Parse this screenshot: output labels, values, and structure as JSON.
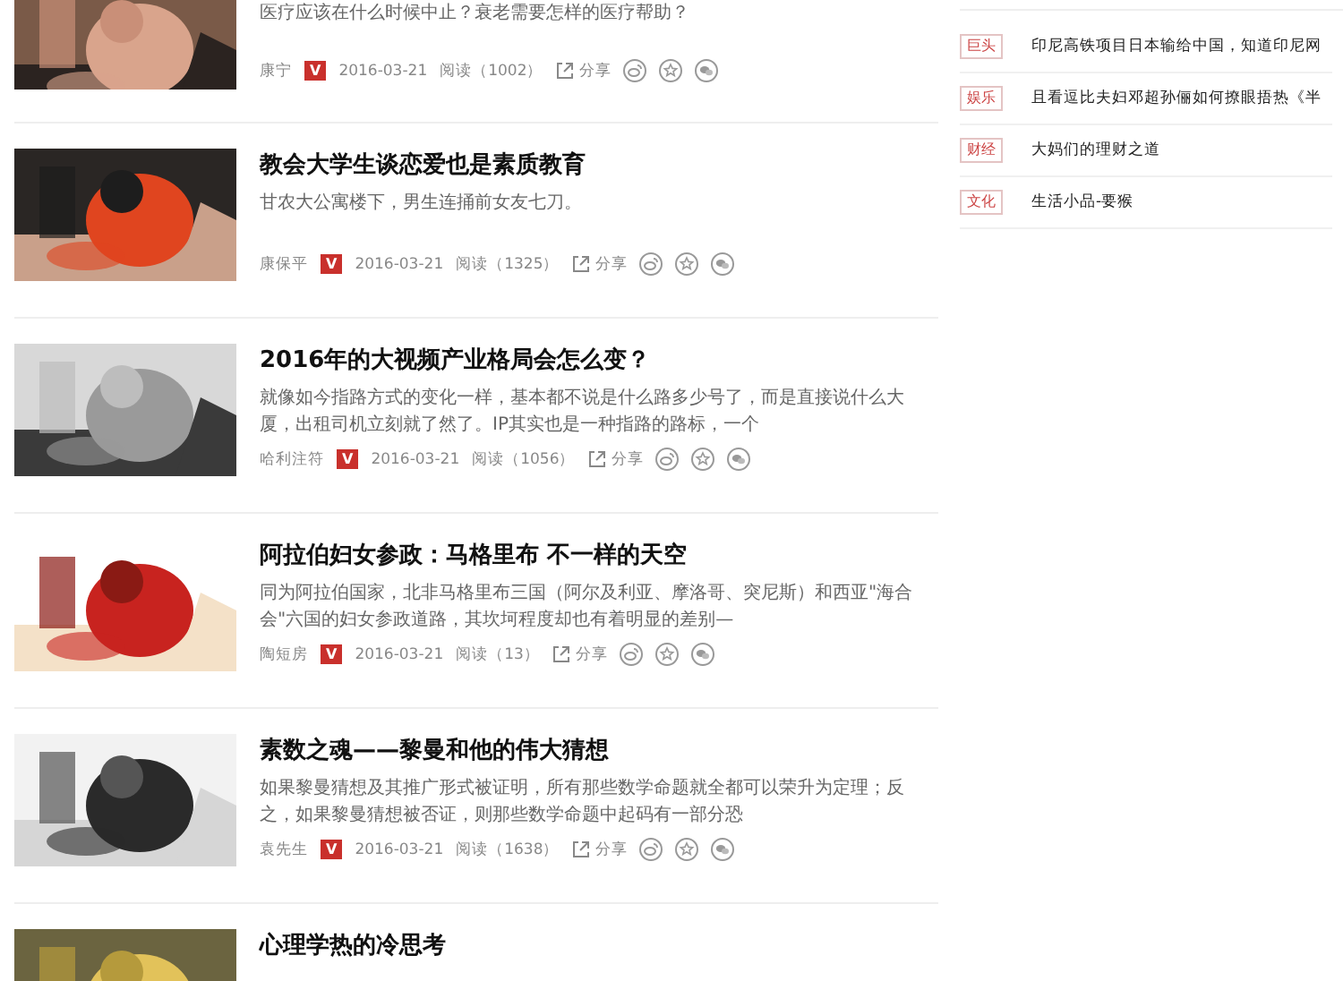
{
  "articles": [
    {
      "description": "医疗应该在什么时候中止？衰老需要怎样的医疗帮助？",
      "author": "康宁",
      "badge": "V",
      "date": "2016-03-21",
      "reads": "阅读（1002）",
      "share": "分享"
    },
    {
      "title": "教会大学生谈恋爱也是素质教育",
      "description": "甘农大公寓楼下，男生连捅前女友七刀。",
      "author": "康保平",
      "badge": "V",
      "date": "2016-03-21",
      "reads": "阅读（1325）",
      "share": "分享"
    },
    {
      "title": "2016年的大视频产业格局会怎么变？",
      "description": "就像如今指路方式的变化一样，基本都不说是什么路多少号了，而是直接说什么大厦，出租司机立刻就了然了。IP其实也是一种指路的路标，一个",
      "author": "哈利注符",
      "badge": "V",
      "date": "2016-03-21",
      "reads": "阅读（1056）",
      "share": "分享"
    },
    {
      "title": "阿拉伯妇女参政：马格里布 不一样的天空",
      "description": "同为阿拉伯国家，北非马格里布三国（阿尔及利亚、摩洛哥、突尼斯）和西亚\"海合会\"六国的妇女参政道路，其坎坷程度却也有着明显的差别—",
      "author": "陶短房",
      "badge": "V",
      "date": "2016-03-21",
      "reads": "阅读（13）",
      "share": "分享"
    },
    {
      "title": "素数之魂——黎曼和他的伟大猜想",
      "description": "如果黎曼猜想及其推广形式被证明，所有那些数学命题就全都可以荣升为定理；反之，如果黎曼猜想被否证，则那些数学命题中起码有一部分恐",
      "author": "袁先生",
      "badge": "V",
      "date": "2016-03-21",
      "reads": "阅读（1638）",
      "share": "分享"
    },
    {
      "title": "心理学热的冷思考"
    }
  ],
  "sidebar": [
    {
      "tag": "巨头",
      "text": "印尼高铁项目日本输给中国，知道印尼网"
    },
    {
      "tag": "娱乐",
      "text": "且看逗比夫妇邓超孙俪如何撩眼捂热《半"
    },
    {
      "tag": "财经",
      "text": "大妈们的理财之道"
    },
    {
      "tag": "文化",
      "text": "生活小品-要猴"
    }
  ]
}
